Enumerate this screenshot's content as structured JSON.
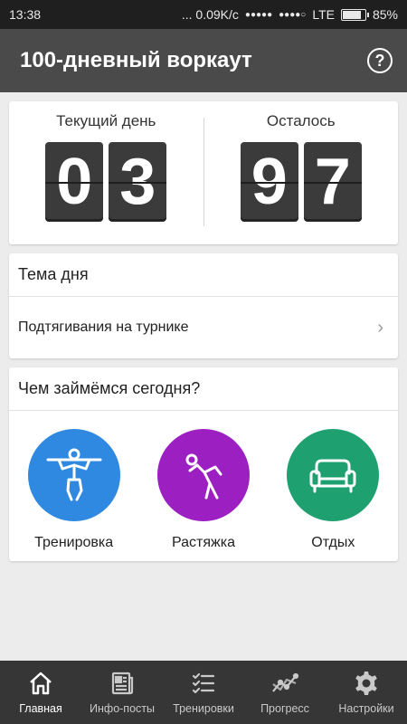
{
  "status_bar": {
    "time": "13:38",
    "speed": "... 0.09K/c",
    "signal_dots": "●●●●●",
    "network_dots": "●●●●○",
    "network": "LTE",
    "battery_percent": "85%",
    "battery_level": 0.85
  },
  "app_bar": {
    "title": "100-дневный воркаут",
    "help_icon": "?"
  },
  "counter": {
    "current_label": "Текущий день",
    "current_digits": [
      "0",
      "3"
    ],
    "remaining_label": "Осталось",
    "remaining_digits": [
      "9",
      "7"
    ]
  },
  "theme": {
    "header": "Тема дня",
    "item": "Подтягивания на турнике",
    "chevron": "›"
  },
  "activities": {
    "header": "Чем займёмся сегодня?",
    "items": [
      {
        "label": "Тренировка",
        "color": "#2f89e0",
        "icon": "pullup-icon"
      },
      {
        "label": "Растяжка",
        "color": "#9b1fc1",
        "icon": "stretch-icon"
      },
      {
        "label": "Отдых",
        "color": "#1ea070",
        "icon": "sofa-icon"
      }
    ]
  },
  "bottom_nav": {
    "items": [
      {
        "label": "Главная",
        "icon": "home-icon",
        "active": true
      },
      {
        "label": "Инфо-посты",
        "icon": "news-icon",
        "active": false
      },
      {
        "label": "Тренировки",
        "icon": "checklist-icon",
        "active": false
      },
      {
        "label": "Прогресс",
        "icon": "progress-icon",
        "active": false
      },
      {
        "label": "Настройки",
        "icon": "gear-icon",
        "active": false
      }
    ]
  }
}
